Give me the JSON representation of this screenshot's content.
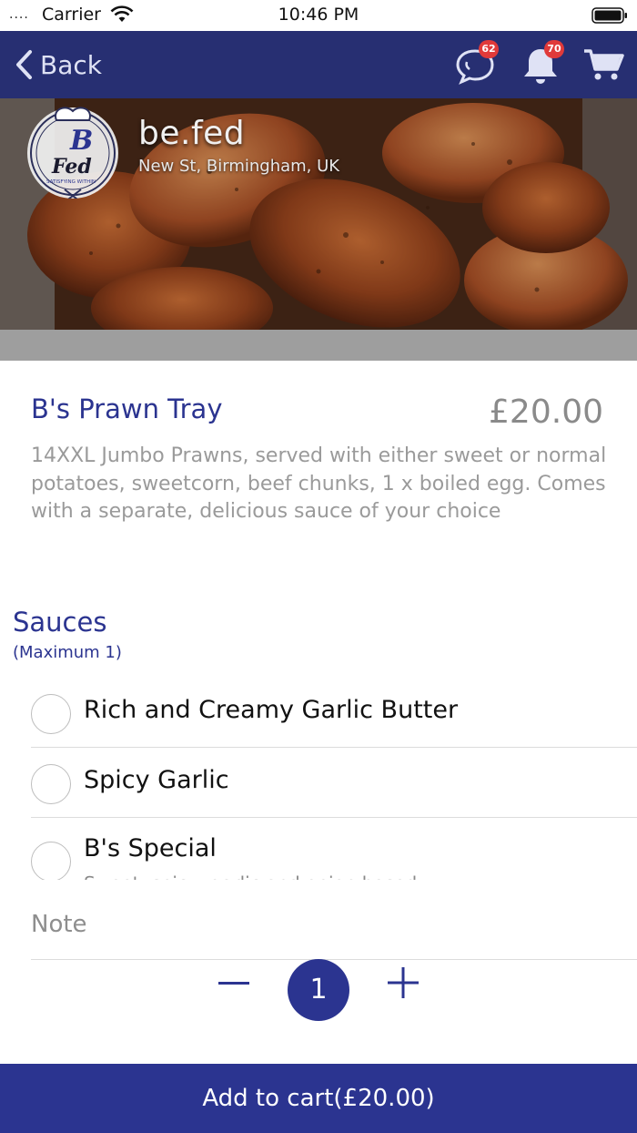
{
  "status_bar": {
    "carrier": "Carrier",
    "time": "10:46 PM",
    "signal": "....",
    "wifi_icon": "wifi-icon",
    "battery_icon": "battery-icon"
  },
  "nav": {
    "back_label": "Back",
    "chat_badge": "62",
    "notification_badge": "70",
    "bg_color": "#272f72"
  },
  "restaurant": {
    "name": "be.fed",
    "address": "New St, Birmingham, UK",
    "logo_text": "B Fed SATISFYING WITHIN"
  },
  "item": {
    "title": "B's Prawn Tray",
    "price": "£20.00",
    "description": "14XXL Jumbo Prawns, served with either sweet or normal potatoes, sweetcorn, beef chunks, 1 x boiled egg. Comes with a separate, delicious sauce of your choice"
  },
  "sauces": {
    "title": "Sauces",
    "subtitle": "(Maximum 1)",
    "options": [
      {
        "label": "Rich and Creamy Garlic Butter",
        "sub": ""
      },
      {
        "label": "Spicy Garlic",
        "sub": ""
      },
      {
        "label": "B's Special",
        "sub": "Sweet, spicy, garlic and onion based"
      }
    ]
  },
  "note": {
    "placeholder": "Note"
  },
  "quantity": {
    "value": "1"
  },
  "cart_button": {
    "label": "Add to cart(£20.00)"
  },
  "colors": {
    "accent": "#2b3490",
    "price": "#8a8a8a",
    "badge": "#e03a3a"
  }
}
